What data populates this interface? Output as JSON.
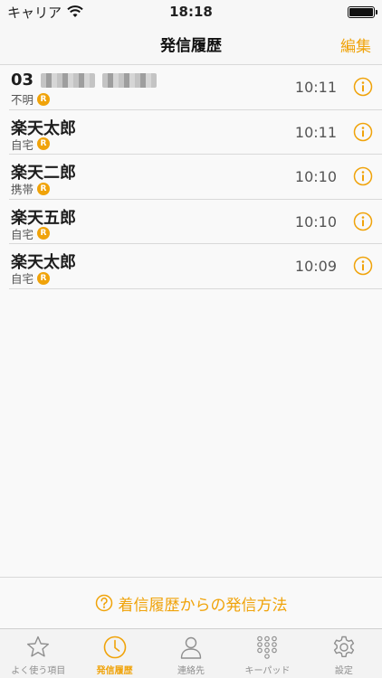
{
  "status_bar": {
    "carrier": "キャリア",
    "time": "18:18"
  },
  "nav": {
    "title": "発信履歴",
    "edit_label": "編集"
  },
  "calls": [
    {
      "name": "03",
      "masked": true,
      "type": "不明",
      "badge": "R",
      "time": "10:11"
    },
    {
      "name": "楽天太郎",
      "masked": false,
      "type": "自宅",
      "badge": "R",
      "time": "10:11"
    },
    {
      "name": "楽天二郎",
      "masked": false,
      "type": "携帯",
      "badge": "R",
      "time": "10:10"
    },
    {
      "name": "楽天五郎",
      "masked": false,
      "type": "自宅",
      "badge": "R",
      "time": "10:10"
    },
    {
      "name": "楽天太郎",
      "masked": false,
      "type": "自宅",
      "badge": "R",
      "time": "10:09"
    }
  ],
  "help": {
    "label": "着信履歴からの発信方法"
  },
  "tabs": [
    {
      "id": "favorites",
      "label": "よく使う項目",
      "icon": "star-icon",
      "active": false
    },
    {
      "id": "history",
      "label": "発信履歴",
      "icon": "clock-icon",
      "active": true
    },
    {
      "id": "contacts",
      "label": "連絡先",
      "icon": "person-icon",
      "active": false
    },
    {
      "id": "keypad",
      "label": "キーパッド",
      "icon": "keypad-icon",
      "active": false
    },
    {
      "id": "settings",
      "label": "設定",
      "icon": "gear-icon",
      "active": false
    }
  ],
  "colors": {
    "accent": "#f0a30a",
    "inactive": "#8e8e8e"
  }
}
